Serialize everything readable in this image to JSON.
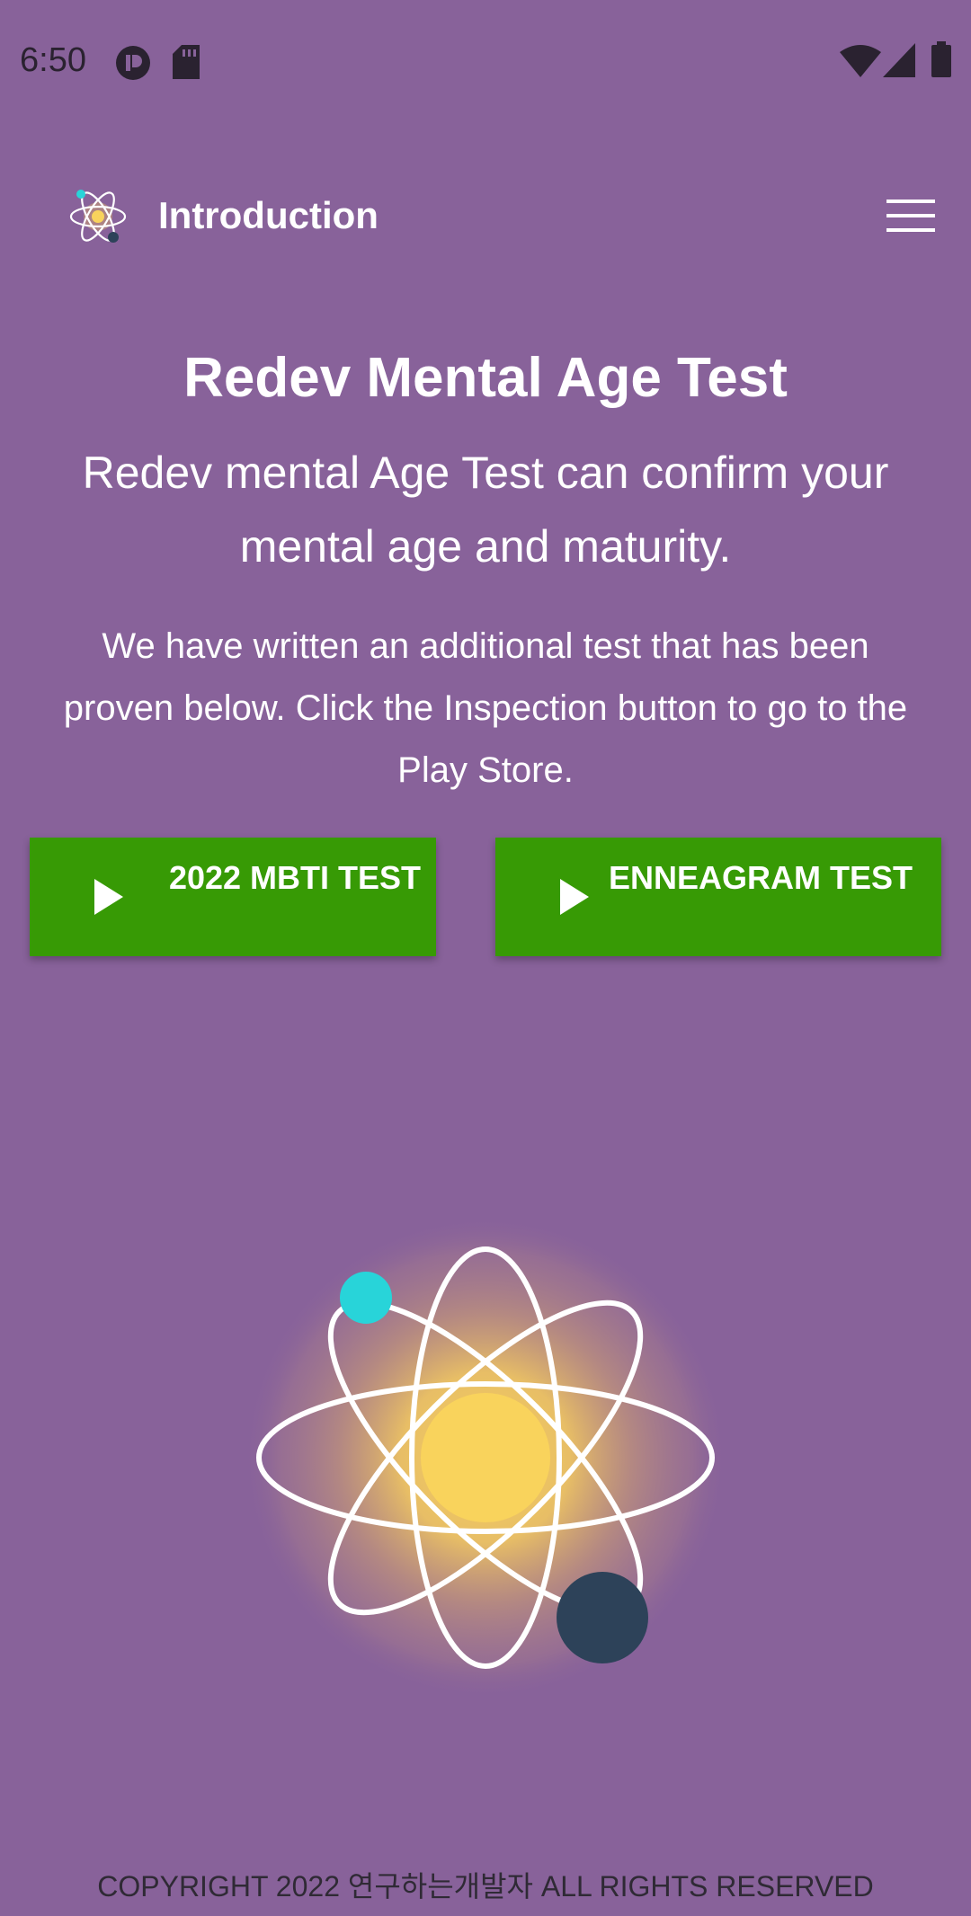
{
  "status_bar": {
    "time": "6:50",
    "icons": [
      "notification-app-icon",
      "sd-card-icon",
      "wifi-icon",
      "cell-signal-icon",
      "battery-icon"
    ]
  },
  "app_bar": {
    "logo": "atom-logo-icon",
    "title": "Introduction",
    "menu_icon": "hamburger-menu-icon"
  },
  "main": {
    "headline": "Redev Mental Age Test",
    "subhead": "Redev mental Age Test can confirm your mental age and maturity.",
    "body": "We have written an additional test that has been proven below. Click the Inspection button to go to the Play Store."
  },
  "buttons": [
    {
      "label": "2022 MBTI TEST",
      "icon": "play-icon"
    },
    {
      "label": "ENNEAGRAM TEST",
      "icon": "play-icon"
    }
  ],
  "illustration": {
    "icon": "atom-illustration",
    "colors": {
      "nucleus": "#f9d35c",
      "orbit": "#ffffff",
      "electron_light": "#28d4d9",
      "electron_dark": "#2d4259"
    }
  },
  "footer": {
    "copyright": "COPYRIGHT 2022 연구하는개발자 ALL RIGHTS RESERVED"
  },
  "colors": {
    "background": "#88629a",
    "button": "#379a05",
    "text": "#ffffff"
  }
}
